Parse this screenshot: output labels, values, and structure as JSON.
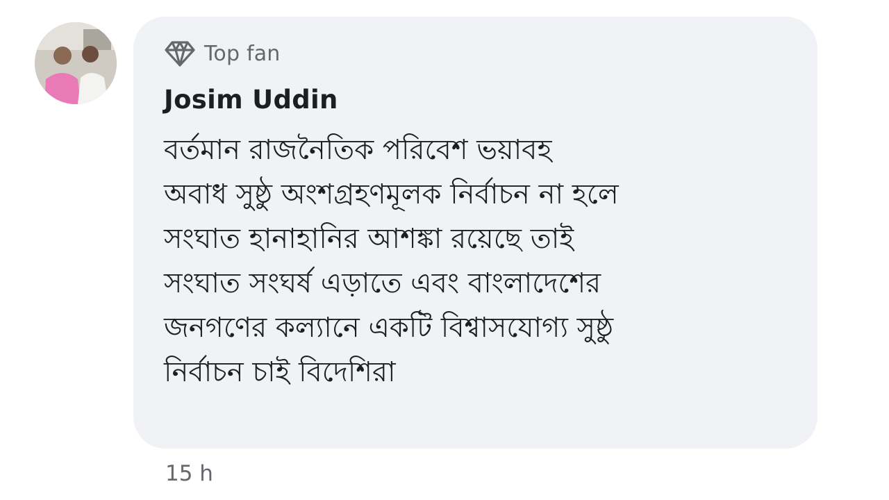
{
  "comment": {
    "badge": {
      "icon": "diamond-icon",
      "label": "Top fan"
    },
    "author": "Josim Uddin",
    "body_lines": [
      "বর্তমান রাজনৈতিক পরিবেশ ভয়াবহ",
      "অবাধ সুষ্ঠু অংশগ্রহণমূলক নির্বাচন না হলে",
      "সংঘাত হানাহানির আশঙ্কা রয়েছে তাই",
      "সংঘাত সংঘর্ষ এড়াতে এবং বাংলাদেশের",
      "জনগণের কল্যানে একটি বিশ্বাসযোগ্য সুষ্ঠু",
      "নির্বাচন চাই বিদেশিরা"
    ],
    "timestamp": "15 h"
  },
  "colors": {
    "bubble_bg": "#f0f2f5",
    "primary_text": "#1c1e21",
    "secondary_text": "#65676b"
  }
}
